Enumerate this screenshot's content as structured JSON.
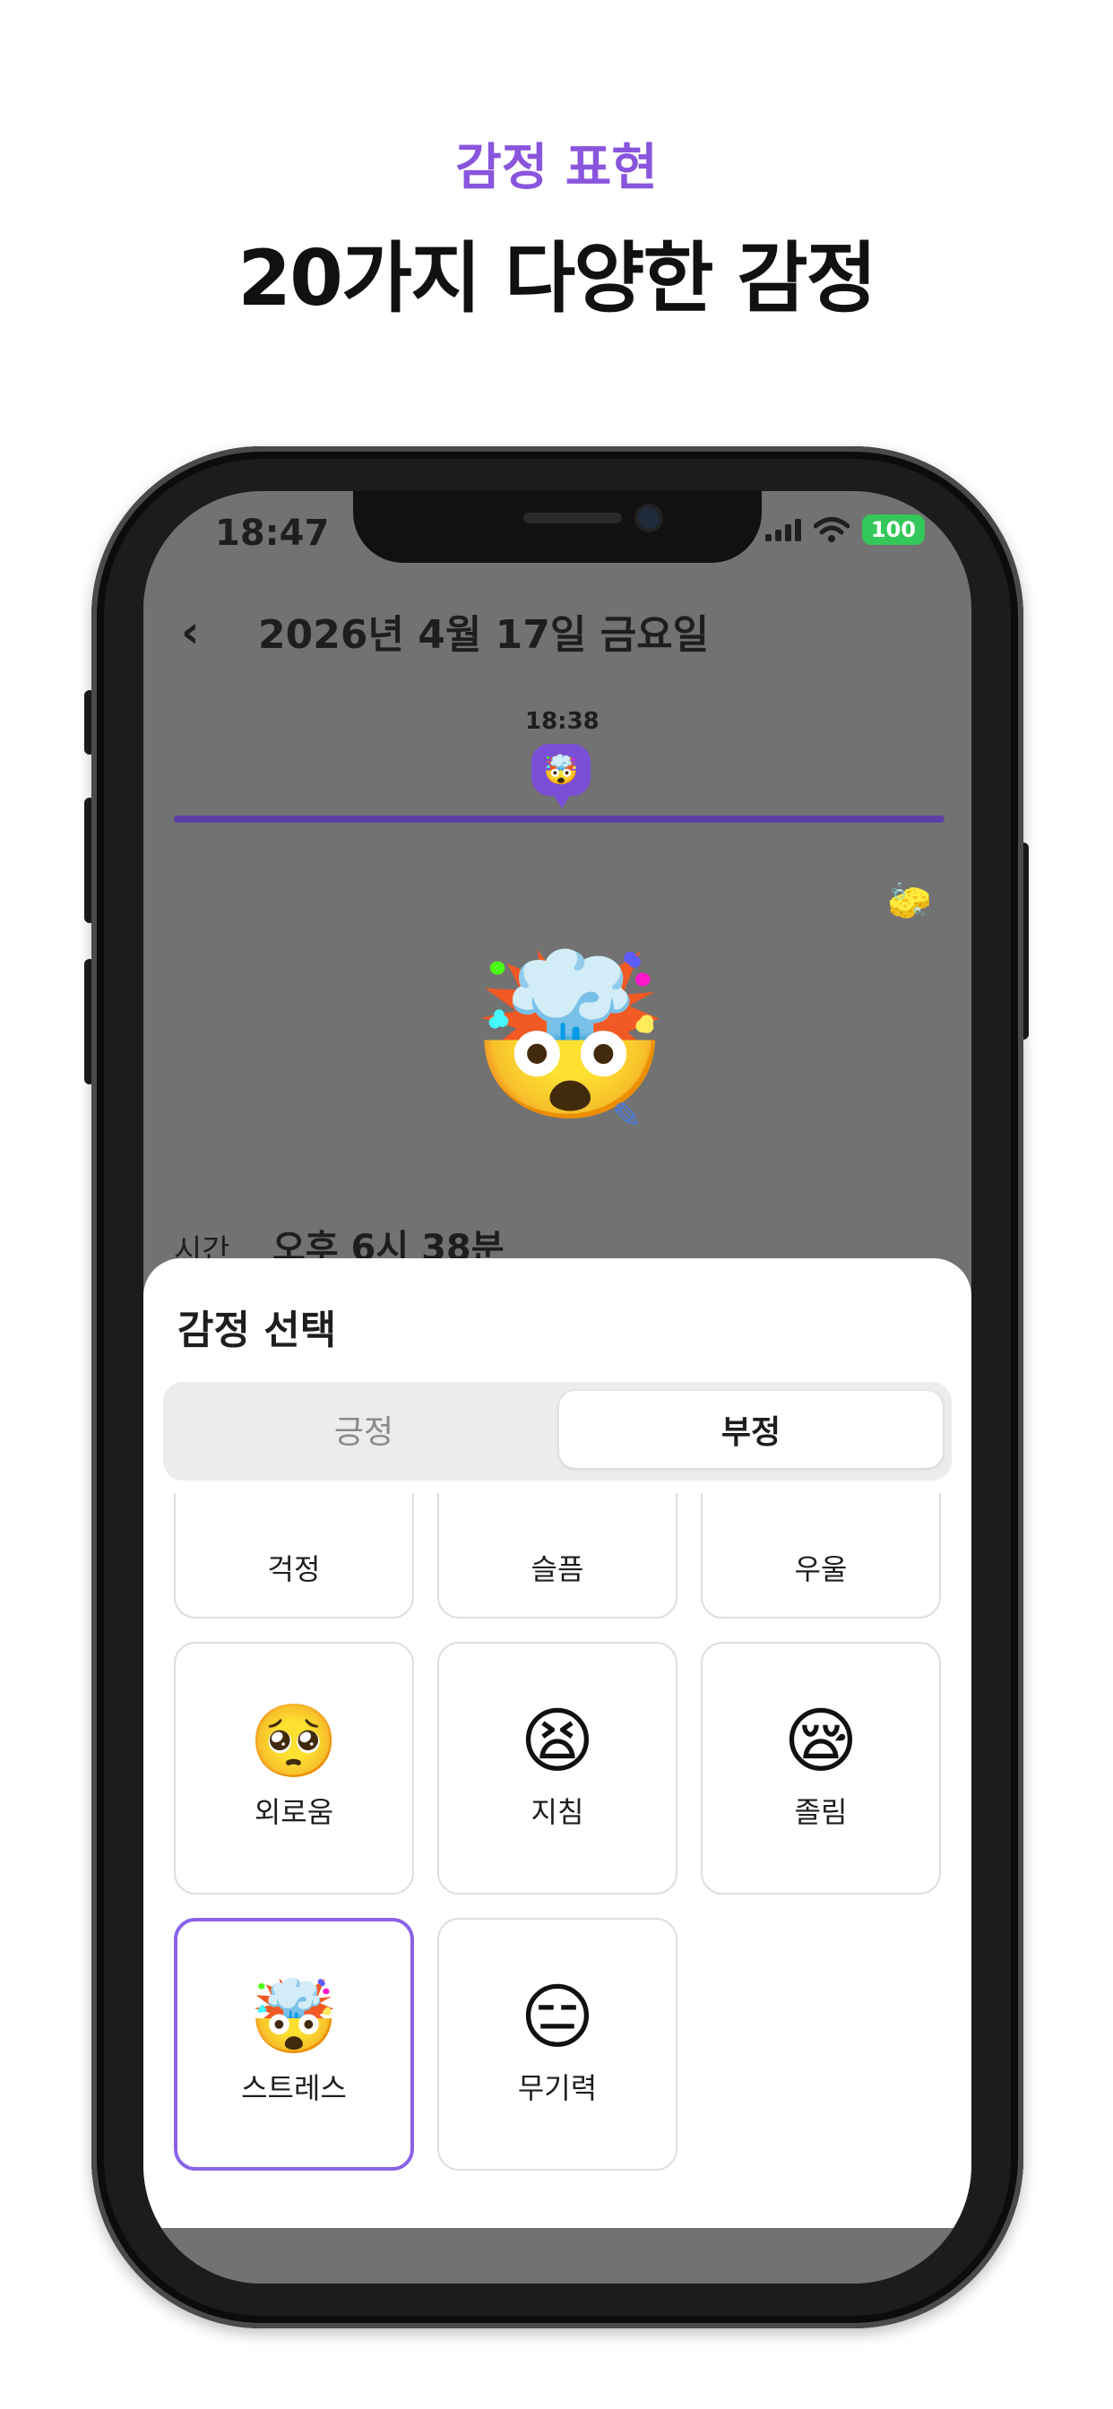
{
  "hero": {
    "subtitle": "감정 표현",
    "title": "20가지 다양한 감정"
  },
  "status_bar": {
    "time": "18:47",
    "battery": "100"
  },
  "header": {
    "back_icon": "chevron-left",
    "date": "2026년 4월 17일 금요일"
  },
  "timeline": {
    "marker_time": "18:38",
    "marker_emoji": "🤯"
  },
  "entry": {
    "emoji": "🤯",
    "eraser_icon": "🧽",
    "edit_icon": "✏",
    "time_label": "시간",
    "time_value": "오후 6시 38분"
  },
  "sheet": {
    "title": "감정 선택",
    "tabs": [
      {
        "label": "긍정",
        "selected": false
      },
      {
        "label": "부정",
        "selected": true
      }
    ],
    "emotions": [
      {
        "emoji": "😟",
        "label": "걱정"
      },
      {
        "emoji": "😢",
        "label": "슬픔"
      },
      {
        "emoji": "😞",
        "label": "우울"
      },
      {
        "emoji": "🥺",
        "label": "외로움"
      },
      {
        "emoji": "😫",
        "label": "지침"
      },
      {
        "emoji": "😪",
        "label": "졸림"
      },
      {
        "emoji": "🤯",
        "label": "스트레스",
        "selected": true
      },
      {
        "emoji": "😑",
        "label": "무기력"
      }
    ]
  },
  "colors": {
    "accent": "#8a55dd",
    "overlay": "#727272",
    "battery": "#34c759"
  }
}
